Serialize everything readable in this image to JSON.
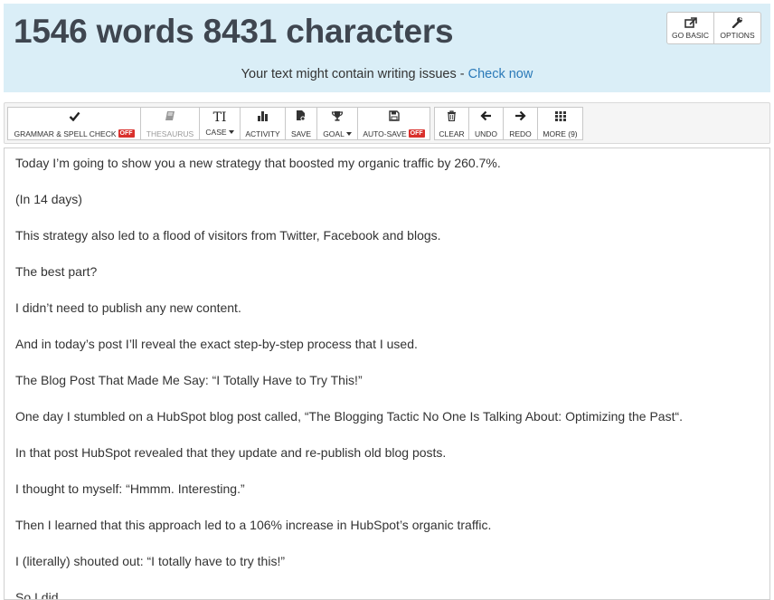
{
  "header": {
    "counter": "1546 words 8431 characters",
    "issues_text": "Your text might contain writing issues - ",
    "issues_link": "Check now",
    "buttons": {
      "go_basic": "GO BASIC",
      "options": "OPTIONS"
    }
  },
  "toolbar": {
    "grammar": {
      "label": "GRAMMAR & SPELL CHECK",
      "badge": "OFF"
    },
    "thesaurus": "THESAURUS",
    "case": "CASE",
    "activity": "ACTIVITY",
    "save": "SAVE",
    "goal": "GOAL",
    "autosave": {
      "label": "AUTO-SAVE",
      "badge": "OFF"
    },
    "clear": "CLEAR",
    "undo": "UNDO",
    "redo": "REDO",
    "more": "MORE (9)"
  },
  "colors": {
    "header_bg": "#daeef7",
    "link": "#2a79b8",
    "badge_off": "#d9302c"
  },
  "editor": {
    "paragraphs": [
      "Today I’m going to show you a new strategy that boosted my organic traffic by 260.7%.",
      "(In 14 days)",
      "This strategy also led to a flood of visitors from Twitter, Facebook and blogs.",
      "The best part?",
      "I didn’t need to publish any new content.",
      "And in today’s post I’ll reveal the exact step-by-step process that I used.",
      "The Blog Post That Made Me Say: “I Totally Have to Try This!”",
      "One day I stumbled on a HubSpot blog post called, “The Blogging Tactic No One Is Talking About: Optimizing the Past“.",
      "In that post HubSpot revealed that they update and re-publish old blog posts.",
      "I thought to myself: “Hmmm. Interesting.”",
      "Then I learned that this approach led to a 106% increase in HubSpot’s organic traffic.",
      "I (literally) shouted out: “I totally have to try this!”",
      "So I did."
    ]
  }
}
